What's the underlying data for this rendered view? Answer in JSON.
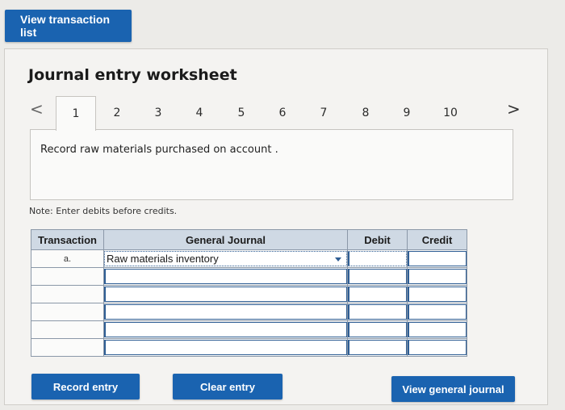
{
  "header": {
    "view_transactions_label": "View transaction list"
  },
  "worksheet": {
    "title": "Journal entry worksheet",
    "prev_glyph": "<",
    "next_glyph": ">",
    "tabs": [
      "1",
      "2",
      "3",
      "4",
      "5",
      "6",
      "7",
      "8",
      "9",
      "10"
    ],
    "active_tab": "1",
    "instruction": "Record raw materials purchased on account .",
    "note": "Note: Enter debits before credits."
  },
  "journal": {
    "headers": {
      "transaction": "Transaction",
      "general_journal": "General Journal",
      "debit": "Debit",
      "credit": "Credit"
    },
    "rows": [
      {
        "transaction": "a.",
        "account": "Raw materials inventory",
        "debit": "",
        "credit": ""
      },
      {
        "transaction": "",
        "account": "",
        "debit": "",
        "credit": ""
      },
      {
        "transaction": "",
        "account": "",
        "debit": "",
        "credit": ""
      },
      {
        "transaction": "",
        "account": "",
        "debit": "",
        "credit": ""
      },
      {
        "transaction": "",
        "account": "",
        "debit": "",
        "credit": ""
      },
      {
        "transaction": "",
        "account": "",
        "debit": "",
        "credit": ""
      }
    ]
  },
  "actions": {
    "record_entry": "Record entry",
    "clear_entry": "Clear entry",
    "view_general_journal": "View general journal"
  },
  "colors": {
    "button_blue": "#1a63b0",
    "header_bg": "#cfd9e4"
  }
}
